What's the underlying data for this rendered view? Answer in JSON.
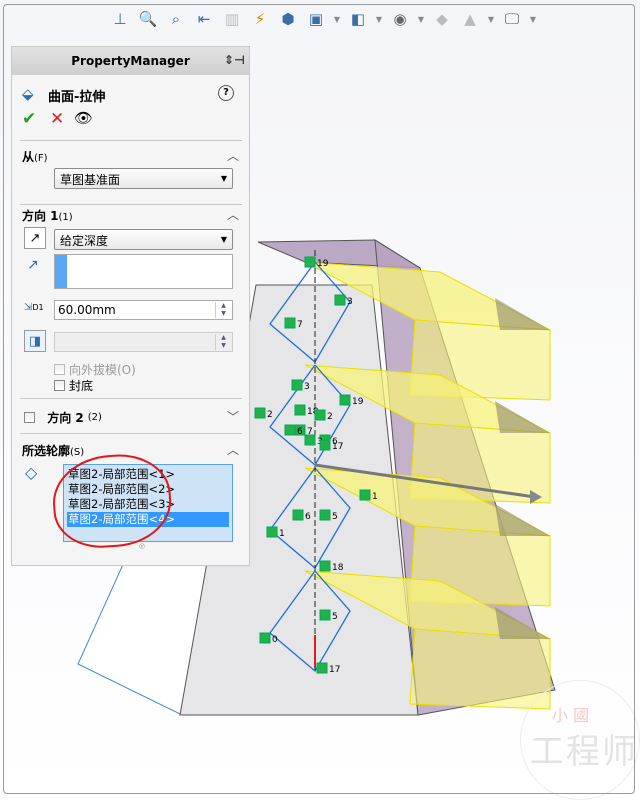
{
  "toolbar": {
    "icons": [
      "normal-to-icon",
      "zoom-to-fit-icon",
      "zoom-to-area-icon",
      "previous-view-icon",
      "section-view-icon",
      "dynamic-annotation-icon",
      "view-orientation-icon",
      "display-style-icon",
      "hide-show-icon",
      "edit-appearance-icon",
      "apply-scene-icon",
      "view-settings-icon"
    ]
  },
  "property_manager": {
    "title": "PropertyManager",
    "feature_name": "曲面-拉伸",
    "help": "?",
    "from": {
      "label": "从",
      "shortcut": "(F)",
      "value": "草图基准面"
    },
    "direction1": {
      "label": "方向 1",
      "shortcut": "(1)",
      "end_condition": "给定深度",
      "depth": "60.00mm",
      "depth_icon_label": "D1",
      "draft_outward": "向外拔模(O)",
      "cap_end": "封底"
    },
    "direction2": {
      "label": "方向 2",
      "shortcut": "(2)"
    },
    "selected_contours": {
      "label": "所选轮廓",
      "shortcut": "(S)",
      "items": [
        "草图2-局部范围<1>",
        "草图2-局部范围<2>",
        "草图2-局部范围<3>",
        "草图2-局部范围<4>"
      ],
      "selected_index": 3
    }
  },
  "sketch_markers": [
    "19",
    "3",
    "7",
    "3",
    "19",
    "18",
    "2",
    "7",
    "6",
    "3",
    "2",
    "6",
    "17",
    "1",
    "5",
    "6",
    "1",
    "18",
    "5",
    "0",
    "17"
  ],
  "watermark": {
    "seal": "小 國",
    "text": "工程师"
  },
  "colors": {
    "accent": "#3399ff",
    "yellow": "#f6f27a",
    "annotation": "#e01818",
    "sketch": "#1e6fd9",
    "relation": "#22b14c"
  }
}
